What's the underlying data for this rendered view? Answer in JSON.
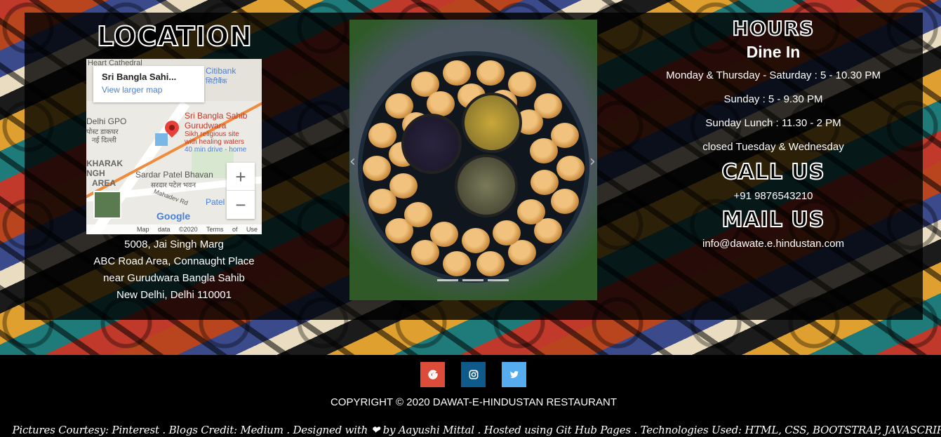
{
  "location": {
    "title": "LOCATION",
    "map": {
      "place_name": "Sri Bangla Sahi...",
      "view_larger": "View larger map",
      "marker_title": "Sri Bangla Sahib",
      "marker_title2": "Gurudwara",
      "marker_desc1": "Sikh religious site",
      "marker_desc2": "with healing waters",
      "marker_drive": "40 min drive - home",
      "label_citibank": "Citibank",
      "label_citibank_hi": "सिटीबैंक",
      "label_cathedral": "Heart Cathedral",
      "label_gpo": "Delhi GPO",
      "label_gpo_hi1": "पोस्ट डाकघर",
      "label_gpo_hi2": "नई दिल्ली",
      "label_kharak": "KHARAK",
      "label_ngh": "NGH",
      "label_area": "AREA",
      "label_sardar": "Sardar Patel Bhavan",
      "label_sardar_hi": "सरदार पटेल भवन",
      "label_mahadev": "Mahadev Rd",
      "label_patel": "Patel",
      "zoom_in": "+",
      "zoom_out": "−",
      "logo": "Google",
      "map_data": "Map data ©2020",
      "terms": "Terms of Use"
    },
    "address": [
      "5008, Jai Singh Marg",
      "ABC Road Area, Connaught Place",
      "near Gurudwara Bangla Sahib",
      "New Delhi, Delhi 110001"
    ]
  },
  "carousel": {
    "prev": "‹",
    "next": "›"
  },
  "hours": {
    "title": "HOURS",
    "subtitle": "Dine In",
    "rows": [
      "Monday & Thursday - Saturday : 5 - 10.30 PM",
      "Sunday : 5 - 9.30 PM",
      "Sunday Lunch : 11.30 - 2 PM",
      "closed Tuesday & Wednesday"
    ]
  },
  "call": {
    "title": "CALL US",
    "phone": "+91 9876543210"
  },
  "mail": {
    "title": "MAIL US",
    "email": "info@dawate.e.hindustan.com"
  },
  "footer": {
    "social": [
      {
        "name": "google",
        "icon": "google-icon",
        "color": "#dd4b39"
      },
      {
        "name": "instagram",
        "icon": "instagram-icon",
        "color": "#0e5a8a"
      },
      {
        "name": "twitter",
        "icon": "twitter-icon",
        "color": "#55acee"
      }
    ],
    "copyright": "COPYRIGHT © 2020 DAWAT-E-HINDUSTAN RESTAURANT",
    "credits_before": "Pictures Courtesy: Pinterest . Blogs Credit: Medium . Designed with",
    "credits_heart": "❤",
    "credits_after": "by Aayushi Mittal . Hosted using Git Hub Pages . Technologies Used: HTML, CSS, BOOTSTRAP, JAVASCRIPT"
  }
}
